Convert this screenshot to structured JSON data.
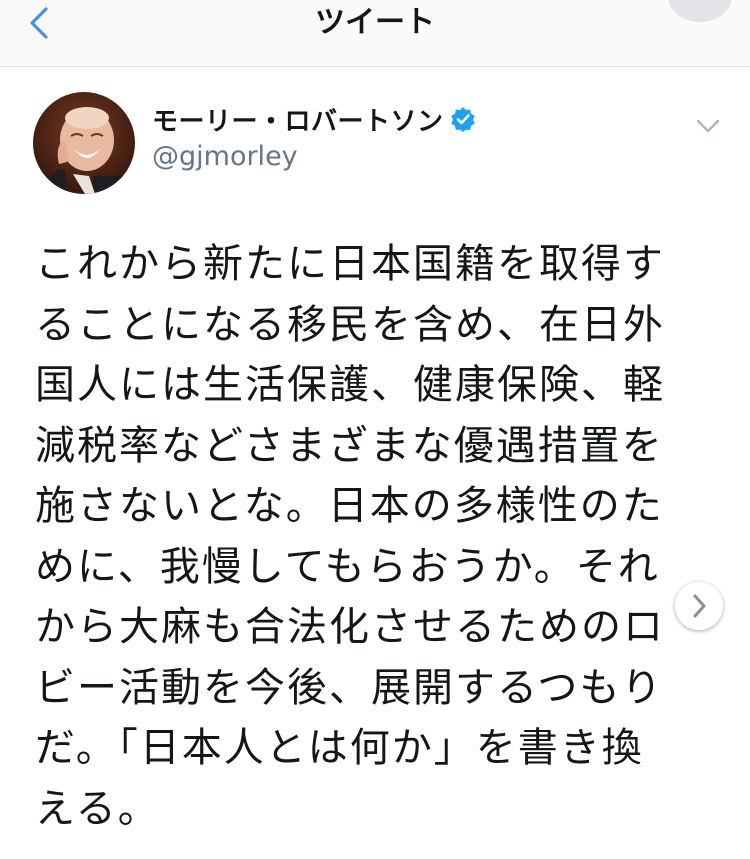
{
  "nav": {
    "title": "ツイート",
    "back_icon": "chevron-left-icon"
  },
  "tweet": {
    "author": {
      "display_name": "モーリー・ロバートソン",
      "handle": "@gjmorley",
      "verified": true
    },
    "text": "これから新たに日本国籍を取得す\nることになる移民を含め、在日外\n国人には生活保護、健康保険、軽\n減税率などさまざまな優遇措置を\n施さないとな。日本の多様性のた\nめに、我慢してもらおうか。それ\nから大麻も合法化させるためのロ\nビー活動を今後、展開するつもり\nだ。「日本人とは何か」を書き換\nえる。"
  },
  "colors": {
    "accent": "#1da1f2",
    "back_chevron": "#4a90e2",
    "verified_badge": "#1da1f2",
    "text_primary": "#14171a",
    "text_secondary": "#657786"
  },
  "icons": {
    "back": "chevron-left-icon",
    "verified": "verified-badge-icon",
    "caret": "chevron-down-icon",
    "next": "chevron-right-icon"
  }
}
